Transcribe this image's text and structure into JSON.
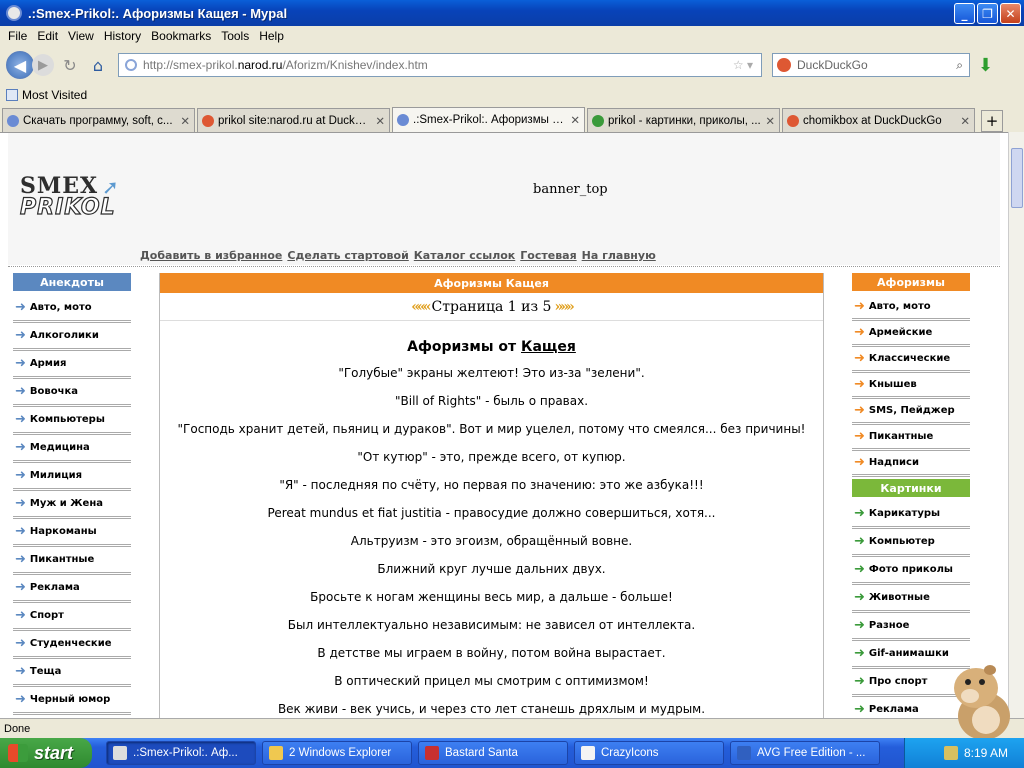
{
  "window": {
    "title": ".:Smex-Prikol:. Афоризмы Кащея - Mypal"
  },
  "menu": [
    "File",
    "Edit",
    "View",
    "History",
    "Bookmarks",
    "Tools",
    "Help"
  ],
  "nav": {
    "url_prefix": "http://smex-prikol.",
    "url_domain": "narod.ru",
    "url_path": "/Aforizm/Knishev/index.htm",
    "search_placeholder": "DuckDuckGo"
  },
  "bookmarks": {
    "most_visited": "Most Visited"
  },
  "tabs": [
    {
      "label": "Скачать программу, soft, c...",
      "icon_color": "#6a8bd4"
    },
    {
      "label": "prikol site:narod.ru at DuckD...",
      "icon_color": "#de5833"
    },
    {
      "label": ".:Smex-Prikol:. Афоризмы Ка...",
      "icon_color": "#6a8bd4"
    },
    {
      "label": "prikol - картинки, приколы, ...",
      "icon_color": "#3a9a3a"
    },
    {
      "label": "chomikbox at DuckDuckGo",
      "icon_color": "#de5833"
    }
  ],
  "page": {
    "logo": {
      "line1": "SMEX",
      "line2": "PRIKOL"
    },
    "banner": "banner_top",
    "top_links": [
      "Добавить в избранное",
      "Сделать стартовой",
      "Каталог ссылок",
      "Гостевая",
      "На главную"
    ],
    "left": {
      "heading": "Анекдоты",
      "items": [
        "Авто, мото",
        "Алкоголики",
        "Армия",
        "Вовочка",
        "Компьютеры",
        "Медицина",
        "Милиция",
        "Муж и Жена",
        "Наркоманы",
        "Пикантные",
        "Реклама",
        "Спорт",
        "Студенческие",
        "Теща",
        "Черный юмор"
      ]
    },
    "right": {
      "heading1": "Афоризмы",
      "items1": [
        "Авто, мото",
        "Армейские",
        "Классические",
        "Кнышев",
        "SMS, Пейджер",
        "Пикантные",
        "Надписи"
      ],
      "heading2": "Картинки",
      "items2": [
        "Карикатуры",
        "Компьютер",
        "Фото приколы",
        "Животные",
        "Разное",
        "Gif-анимашки",
        "Про спорт",
        "Реклама"
      ]
    },
    "center": {
      "heading": "Афоризмы Кащея",
      "pager": "Страница 1 из 5",
      "title_prefix": "Афоризмы от",
      "title_link": "Кащея",
      "aphorisms": [
        "\"Голубые\" экраны желтеют! Это из-за \"зелени\".",
        "\"Bill of Rights\" - быль о правах.",
        "\"Господь хранит детей, пьяниц и дураков\". Вот и мир уцелел, потому что смеялся... без причины!",
        "\"От кутюр\" - это, прежде всего, от купюр.",
        "\"Я\" - последняя по счёту, но первая по значению: это же азбука!!!",
        "Pereat mundus et fiat justitia - правосудие должно совершиться, хотя...",
        "Альтруизм - это эгоизм, обращённый вовне.",
        "Ближний круг лучше дальних двух.",
        "Бросьте к ногам женщины весь мир, а дальше - больше!",
        "Был интеллектуально независимым: не зависел от интеллекта.",
        "В детстве мы играем в войну, потом война вырастает.",
        "В оптический прицел мы смотрим с оптимизмом!",
        "Век живи - век учись, и через сто лет станешь дряхлым и мудрым."
      ]
    }
  },
  "status": "Done",
  "taskbar": {
    "start": "start",
    "tasks": [
      ".:Smex-Prikol:. Аф...",
      "2 Windows Explorer",
      "Bastard Santa",
      "CrazyIcons",
      "AVG Free Edition - ..."
    ],
    "clock": "8:19 AM"
  }
}
